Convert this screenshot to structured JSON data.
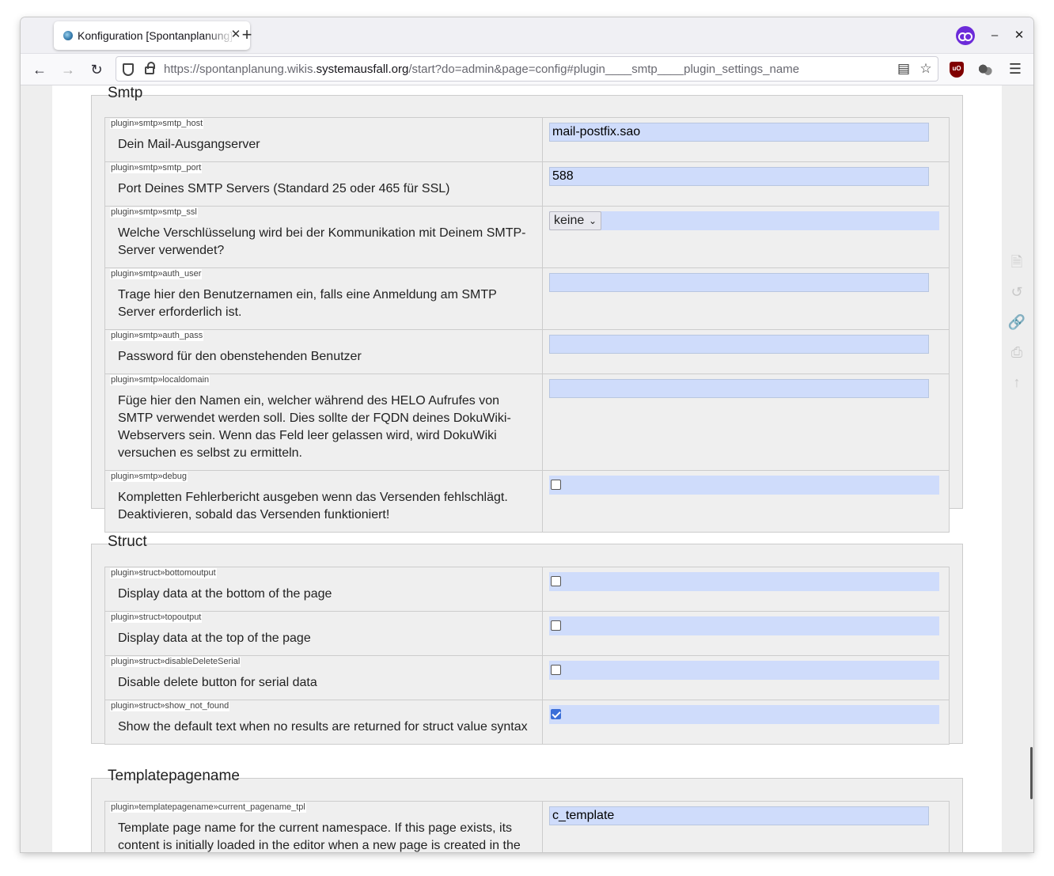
{
  "browser": {
    "tab_title": "Konfiguration [Spontanplanung]",
    "tab_close": "✕",
    "new_tab": "+",
    "url_prefix": "https://spontanplanung.wikis.",
    "url_domain": "systemausfall.org",
    "url_suffix": "/start?do=admin&page=config#plugin____smtp____plugin_settings_name",
    "window_minimize": "–",
    "window_close": "✕"
  },
  "sections": {
    "smtp": {
      "title": "Smtp",
      "rows": [
        {
          "key": "plugin»smtp»smtp_host",
          "label": "Dein Mail-Ausgangserver",
          "value": "mail-postfix.sao"
        },
        {
          "key": "plugin»smtp»smtp_port",
          "label": "Port Deines SMTP Servers (Standard 25 oder 465 für SSL)",
          "value": "588"
        },
        {
          "key": "plugin»smtp»smtp_ssl",
          "label": "Welche Verschlüsselung wird bei der Kommunikation mit Deinem SMTP-Server verwendet?",
          "value": "keine"
        },
        {
          "key": "plugin»smtp»auth_user",
          "label": "Trage hier den Benutzernamen ein, falls eine Anmeldung am SMTP Server erforderlich ist.",
          "value": ""
        },
        {
          "key": "plugin»smtp»auth_pass",
          "label": "Password für den obenstehenden Benutzer",
          "value": ""
        },
        {
          "key": "plugin»smtp»localdomain",
          "label": "Füge hier den Namen ein, welcher während des HELO Aufrufes von SMTP verwendet werden soll. Dies sollte der FQDN deines DokuWiki-Webservers sein. Wenn das Feld leer gelassen wird, wird DokuWiki versuchen es selbst zu ermitteln.",
          "value": ""
        },
        {
          "key": "plugin»smtp»debug",
          "label": "Kompletten Fehlerbericht ausgeben wenn das Versenden fehlschlägt. Deaktivieren, sobald das Versenden funktioniert!",
          "checked": false
        }
      ]
    },
    "struct": {
      "title": "Struct",
      "rows": [
        {
          "key": "plugin»struct»bottomoutput",
          "label": "Display data at the bottom of the page",
          "checked": false
        },
        {
          "key": "plugin»struct»topoutput",
          "label": "Display data at the top of the page",
          "checked": false
        },
        {
          "key": "plugin»struct»disableDeleteSerial",
          "label": "Disable delete button for serial data",
          "checked": false
        },
        {
          "key": "plugin»struct»show_not_found",
          "label": "Show the default text when no results are returned for struct value syntax",
          "checked": true
        }
      ]
    },
    "templatepagename": {
      "title": "Templatepagename",
      "rows": [
        {
          "key": "plugin»templatepagename»current_pagename_tpl",
          "label": "Template page name for the current namespace. If this page exists, its content is initially loaded in the editor when a new page is created in the same namespace.",
          "value": "c_template"
        }
      ]
    }
  },
  "colors": {
    "input_bg": "#cfdcfb",
    "fieldset_bg": "#efefef",
    "checkbox_checked": "#3b6fd8"
  }
}
